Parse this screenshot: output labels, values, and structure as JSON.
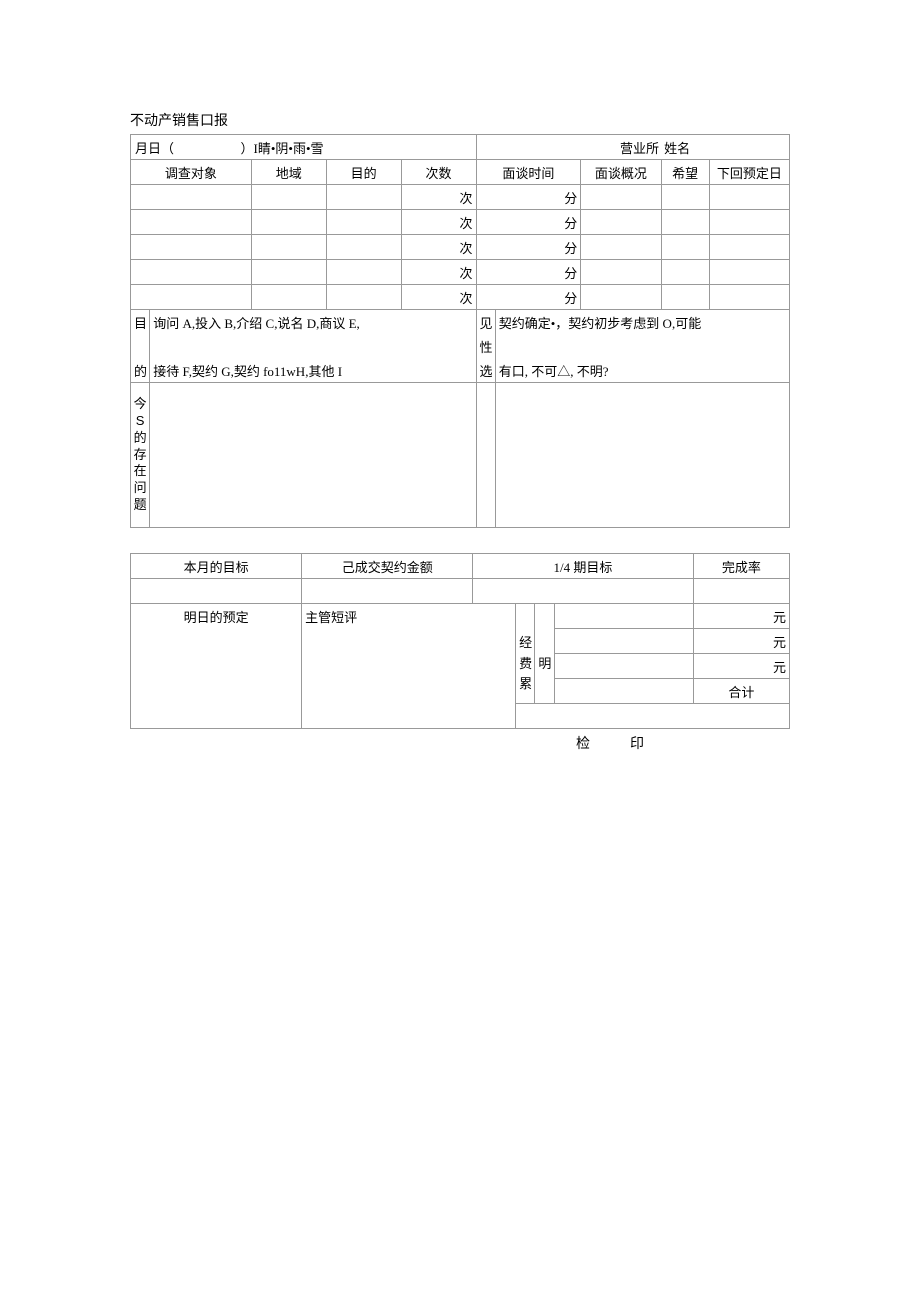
{
  "title": "不动产销售口报",
  "table1": {
    "header": {
      "date_label": "月日（",
      "weather_sep": "）I",
      "weather": "睛•阴•雨•雪",
      "office_label": "营业所",
      "name_label": "姓名"
    },
    "cols": {
      "survey_target": "调查对象",
      "region": "地域",
      "purpose": "目的",
      "count": "次数",
      "interview_time": "面谈时间",
      "interview_summary": "面谈概况",
      "hope": "希望",
      "next_date": "下回预定日"
    },
    "rows": [
      {
        "count": "次",
        "time": "分"
      },
      {
        "count": "次",
        "time": "分"
      },
      {
        "count": "次",
        "time": "分"
      },
      {
        "count": "次",
        "time": "分"
      },
      {
        "count": "次",
        "time": "分"
      }
    ],
    "legend": {
      "mu_label": "目",
      "di_label": "的",
      "line1": "询问 A,投入 B,介绍 C,说名 D,商议 E,",
      "line2": "接待 F,契约 G,契约 fo11wH,其他 I",
      "jian_label": "见",
      "xing_label": "性",
      "xuan_label": "选",
      "poss_line1": "契约确定•，契约初步考虑到 O,可能",
      "poss_line2": "有口, 不可△, 不明?"
    },
    "problem_label_chars": [
      "今",
      "S",
      "的",
      "存",
      "在",
      "问",
      "题"
    ]
  },
  "table2": {
    "header": {
      "month_target": "本月的目标",
      "contract_amount": "己成交契约金额",
      "quarter_target": "1/4 期目标",
      "complete_rate": "完成率"
    },
    "row2": {
      "tomorrow_plan": "明日的预定",
      "supervisor_comment": "主管短评"
    },
    "expense_label_chars": [
      "经",
      "费",
      "累"
    ],
    "ming_char": "明",
    "yuan": "元",
    "total": "合计",
    "check": "检",
    "seal": "印"
  }
}
